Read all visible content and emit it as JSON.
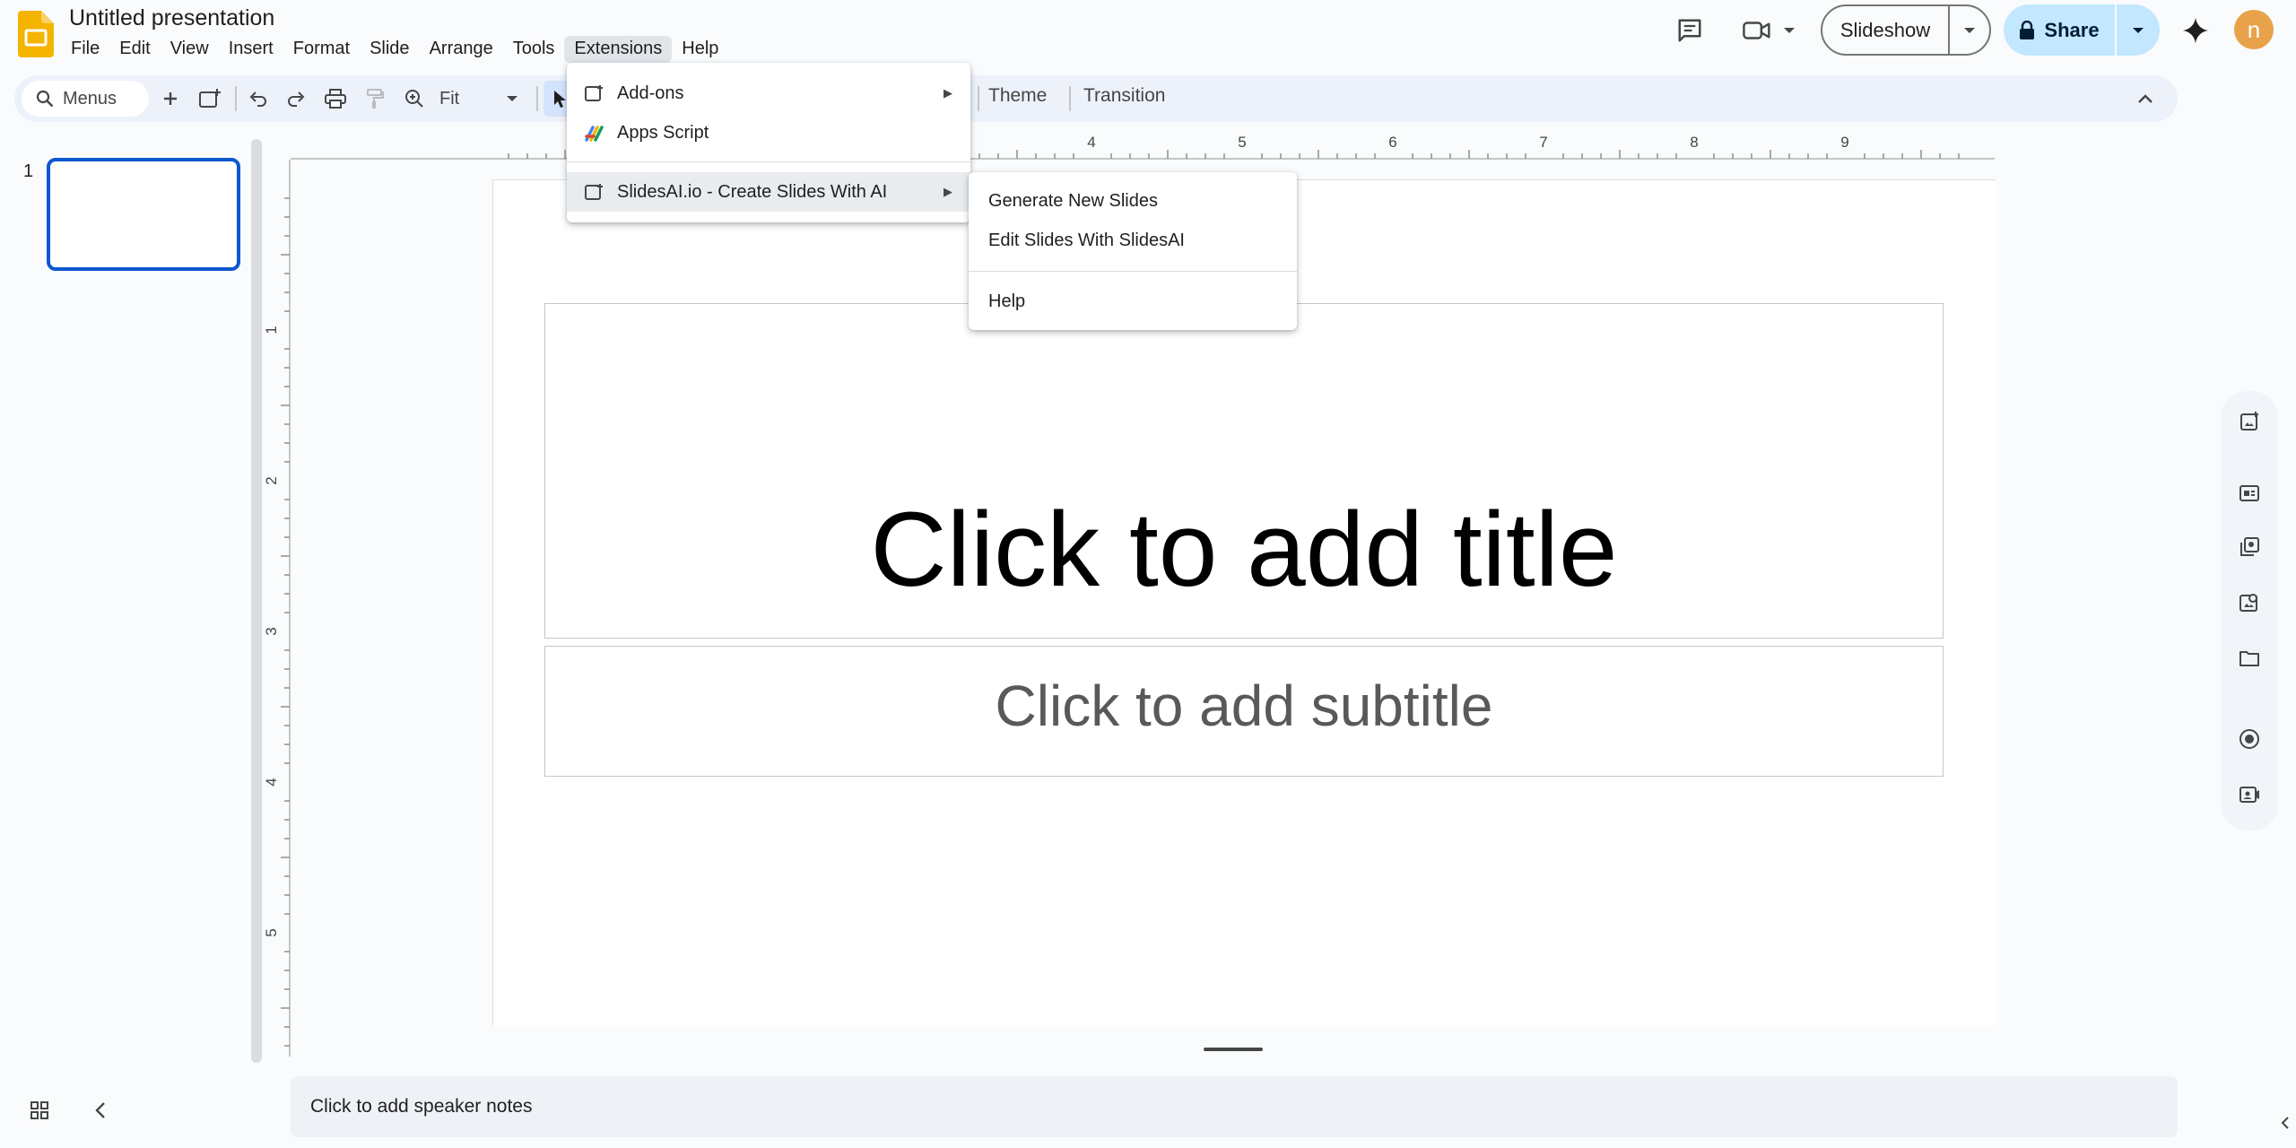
{
  "app": {
    "doc_title": "Untitled presentation",
    "logo_icon": "google-slides-logo",
    "avatar_letter": "n",
    "avatar_color": "#e8a24a",
    "accent_color": "#0b57d0"
  },
  "menubar": {
    "items": [
      "File",
      "Edit",
      "View",
      "Insert",
      "Format",
      "Slide",
      "Arrange",
      "Tools",
      "Extensions",
      "Help"
    ],
    "active": "Extensions"
  },
  "header": {
    "slideshow_label": "Slideshow",
    "share_label": "Share",
    "icons": [
      "comments-icon",
      "video-camera-icon",
      "lock-icon",
      "gemini-icon"
    ]
  },
  "toolbar": {
    "search_placeholder": "Menus",
    "zoom_value": "Fit",
    "theme_label": "Theme",
    "transition_label": "Transition",
    "icons": [
      "search-icon",
      "add-icon",
      "new-slide-icon",
      "undo-icon",
      "redo-icon",
      "print-icon",
      "paint-format-icon",
      "zoom-icon",
      "select-icon",
      "collapse-icon"
    ]
  },
  "ruler": {
    "h_labels": [
      "4",
      "5",
      "6",
      "7",
      "8",
      "9"
    ],
    "v_labels": [
      "1",
      "2",
      "3",
      "4",
      "5"
    ]
  },
  "filmstrip": {
    "slide_number": "1"
  },
  "slide": {
    "title_placeholder": "Click to add title",
    "subtitle_placeholder": "Click to add subtitle"
  },
  "notes": {
    "placeholder": "Click to add speaker notes"
  },
  "extensions_menu": {
    "items": [
      {
        "label": "Add-ons",
        "icon": "add-ons-icon",
        "has_submenu": true
      },
      {
        "label": "Apps Script",
        "icon": "apps-script-icon",
        "has_submenu": false
      },
      {
        "label": "SlidesAI.io - Create Slides With AI",
        "icon": "add-on-app-icon",
        "has_submenu": true,
        "highlighted": true
      }
    ]
  },
  "slidesai_submenu": {
    "items": [
      "Generate New Slides",
      "Edit Slides With SlidesAI",
      "Help"
    ]
  },
  "side_panel": {
    "icons": [
      "add-slide-icon",
      "layout-icon",
      "gallery-icon",
      "image-search-icon",
      "folder-icon",
      "record-icon",
      "video-icon"
    ]
  }
}
